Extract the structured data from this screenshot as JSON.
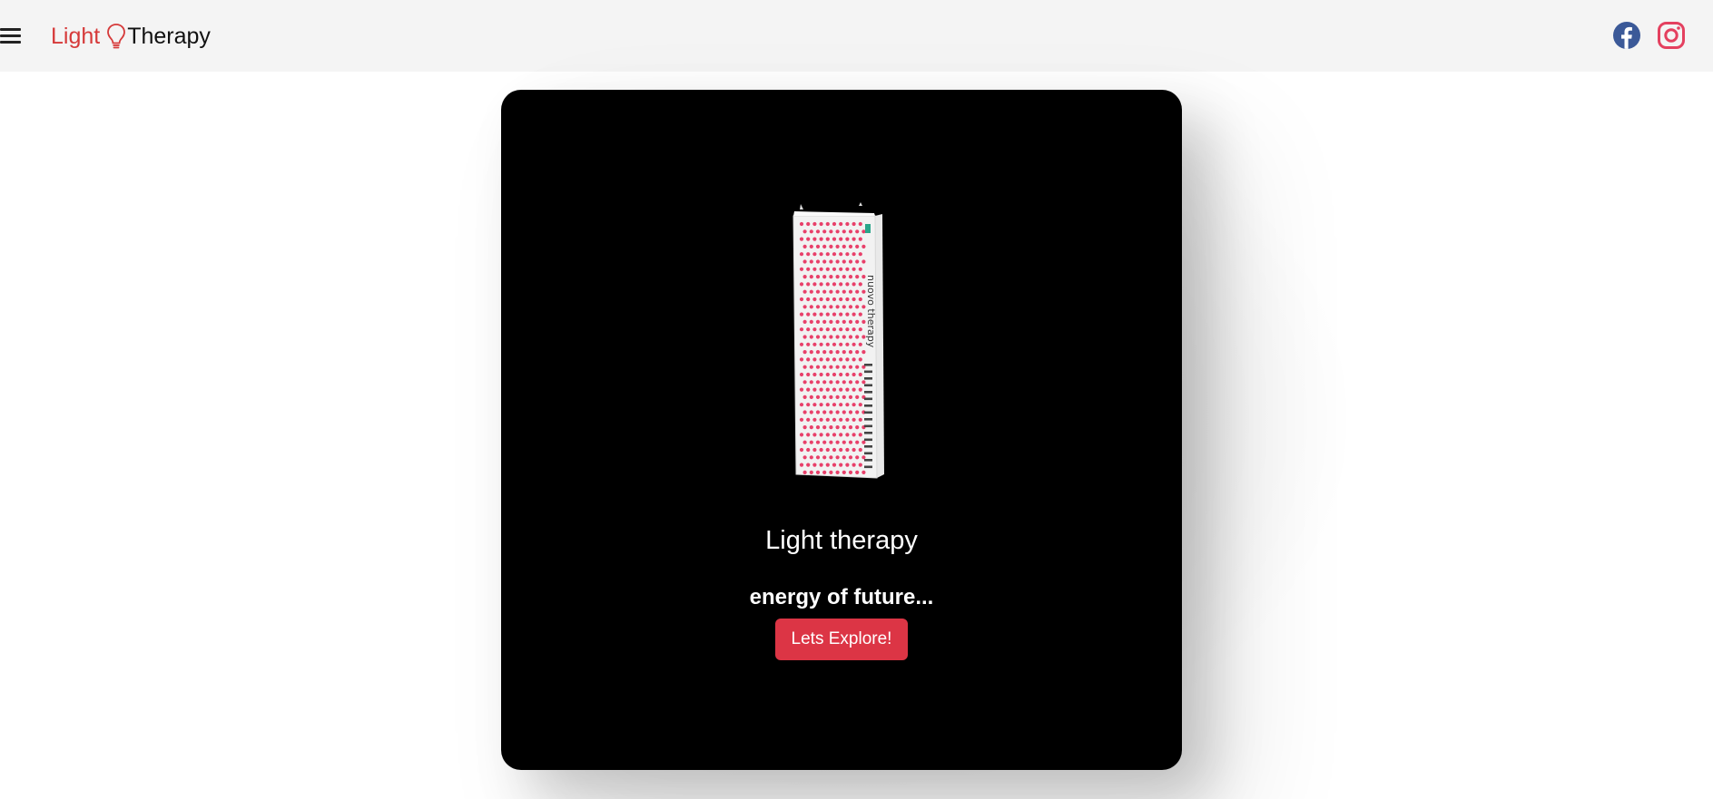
{
  "navbar": {
    "menu_icon": "hamburger-menu-icon",
    "brand": {
      "part1": "Light",
      "icon": "lightbulb-icon",
      "part2": "Therapy"
    },
    "social": [
      {
        "name": "Facebook",
        "icon": "facebook-icon",
        "color": "#3b5998"
      },
      {
        "name": "Instagram",
        "icon": "instagram-icon",
        "color": "#e4405f"
      }
    ]
  },
  "hero": {
    "image": "light-therapy-panel-image",
    "device_text": "nuovo therapy",
    "title": "Light therapy",
    "subtitle": "energy of future...",
    "cta_label": "Lets Explore!"
  },
  "colors": {
    "brand_red": "#d63a3a",
    "button_red": "#dc3545",
    "navbar_bg": "#f4f4f4",
    "card_bg": "#000000"
  }
}
